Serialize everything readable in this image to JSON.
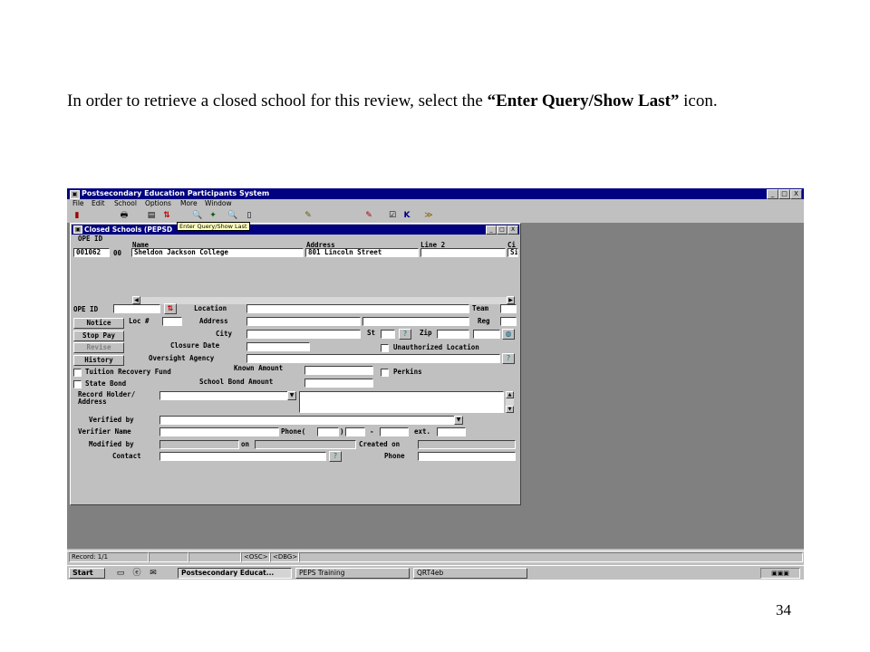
{
  "caption": {
    "part1": "In order to retrieve a closed school for this review, select the ",
    "bold": "“Enter Query/Show Last”",
    "part2": " icon."
  },
  "page_number": "34",
  "app": {
    "title": "Postsecondary Education Participants System",
    "menu": [
      "File",
      "Edit",
      "School",
      "Options",
      "More",
      "Window"
    ],
    "tooltip": "Enter Query/Show Last",
    "window_buttons": [
      "_",
      "□",
      "X"
    ]
  },
  "child": {
    "title": "Closed Schools (PEPSD",
    "header_labels": {
      "ope_id": "OPE ID",
      "name": "Name",
      "address": "Address",
      "line2": "Line 2",
      "ci": "Ci"
    },
    "record": {
      "ope_id": "001062",
      "ope_suffix": "00",
      "name": "Sheldon Jackson College",
      "address": "801 Lincoln Street",
      "line2": "",
      "ci": "Si"
    },
    "buttons": [
      "Notice",
      "Stop Pay",
      "Revise",
      "History"
    ],
    "labels": {
      "ope_id": "OPE ID",
      "loc": "Loc #",
      "location": "Location",
      "team": "Team",
      "address": "Address",
      "reg": "Reg",
      "city": "City",
      "st": "St",
      "zip": "Zip",
      "closure_date": "Closure Date",
      "unauthorized_location": "Unauthorized Location",
      "oversight_agency": "Oversight Agency",
      "tuition_recovery_fund": "Tuition Recovery Fund",
      "known_amount": "Known Amount",
      "perkins": "Perkins",
      "state_bond": "State Bond",
      "school_bond_amount": "School Bond Amount",
      "record_holder": "Record Holder/",
      "record_holder_address": "Address",
      "verified_by": "Verified by",
      "verifier_name": "Verifier Name",
      "phone_open": "Phone(",
      "phone_close": ")",
      "dash": "-",
      "ext": "ext.",
      "modified_by": "Modified by",
      "on": "on",
      "created_on": "Created on",
      "contact": "Contact",
      "phone": "Phone"
    }
  },
  "status": {
    "record": "Record: 1/1",
    "osc": "<OSC>",
    "dbg": "<DBG>"
  },
  "taskbar": {
    "start": "Start",
    "tasks": [
      "Postsecondary Educat...",
      "PEPS Training",
      "QRT4eb"
    ]
  }
}
